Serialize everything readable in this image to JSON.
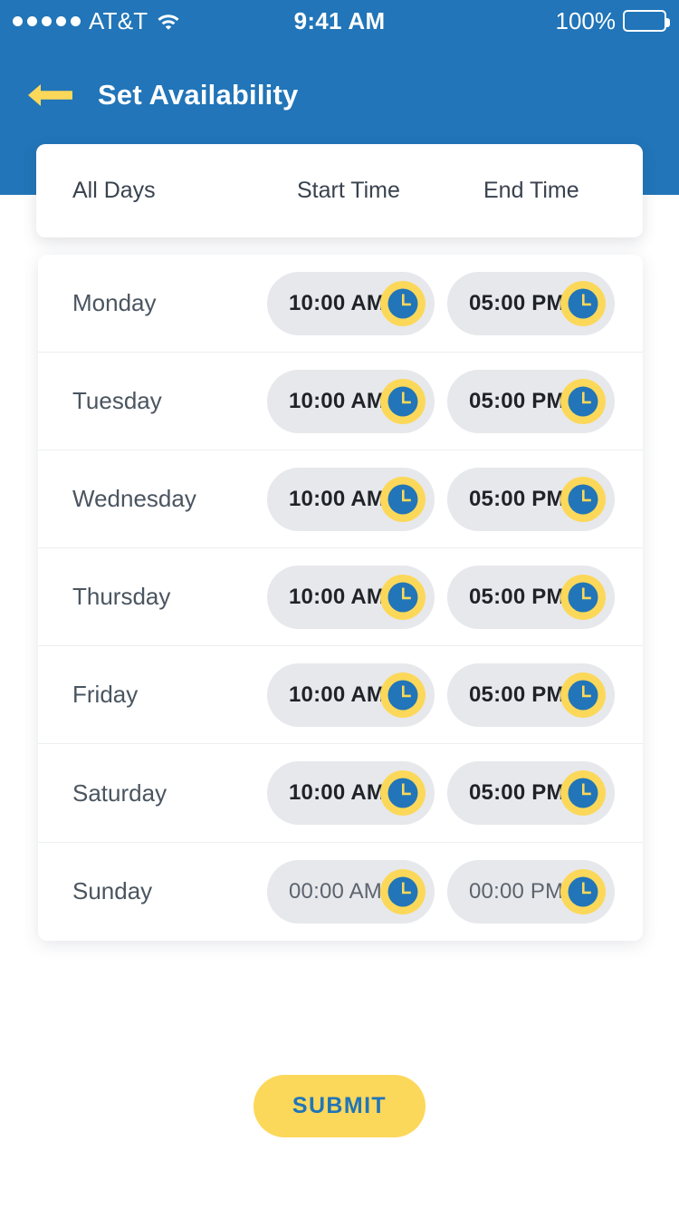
{
  "colors": {
    "header_blue": "#2175B8",
    "accent_yellow": "#FCD85A",
    "pill_gray": "#E7E8EC",
    "text_dark": "#39424E",
    "row_text": "#4A5560",
    "card_white": "#FFFFFF",
    "divider": "#EDEEF1",
    "muted_text": "#5C646E"
  },
  "status_bar": {
    "signal_dots": 5,
    "carrier": "AT&T",
    "wifi_icon": "wifi-icon",
    "time": "9:41 AM",
    "battery_percent": "100%",
    "battery_icon": "battery-icon"
  },
  "nav": {
    "back_icon": "back-arrow-icon",
    "title": "Set Availability"
  },
  "table": {
    "headers": {
      "days": "All Days",
      "start": "Start Time",
      "end": "End Time"
    },
    "clock_icon": "clock-icon",
    "rows": [
      {
        "day": "Monday",
        "start": "10:00 AM",
        "end": "05:00 PM",
        "muted": false
      },
      {
        "day": "Tuesday",
        "start": "10:00 AM",
        "end": "05:00 PM",
        "muted": false
      },
      {
        "day": "Wednesday",
        "start": "10:00 AM",
        "end": "05:00 PM",
        "muted": false
      },
      {
        "day": "Thursday",
        "start": "10:00 AM",
        "end": "05:00 PM",
        "muted": false
      },
      {
        "day": "Friday",
        "start": "10:00 AM",
        "end": "05:00 PM",
        "muted": false
      },
      {
        "day": "Saturday",
        "start": "10:00 AM",
        "end": "05:00 PM",
        "muted": false
      },
      {
        "day": "Sunday",
        "start": "00:00 AM",
        "end": "00:00 PM",
        "muted": true
      }
    ]
  },
  "footer": {
    "submit_label": "SUBMIT"
  }
}
